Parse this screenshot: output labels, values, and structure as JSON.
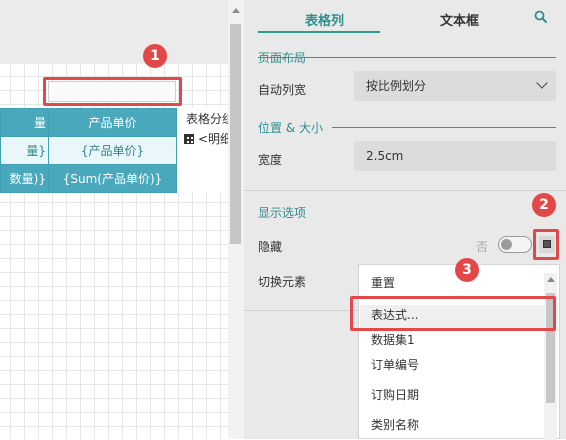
{
  "tabs": {
    "table_column": "表格列",
    "text_box": "文本框"
  },
  "sections": {
    "page_layout": {
      "title": "页面布局",
      "auto_width_label": "自动列宽",
      "auto_width_value": "按比例划分"
    },
    "position_size": {
      "title": "位置 & 大小",
      "width_label": "宽度",
      "width_value": "2.5cm"
    },
    "display_options": {
      "title": "显示选项",
      "hidden_label": "隐藏",
      "toggle_off_text": "否",
      "toggle_element_label": "切换元素"
    }
  },
  "dropdown": {
    "items": [
      "重置",
      "表达式...",
      "数据集1",
      "订单编号",
      "订购日期",
      "类别名称"
    ]
  },
  "table": {
    "header": [
      "量",
      "产品单价"
    ],
    "detail": [
      "量}",
      "{产品单价}"
    ],
    "footer": [
      "数量)}",
      "{Sum(产品单价)}"
    ],
    "group_label": "表格分组",
    "group_item": "<明细"
  },
  "callouts": [
    "1",
    "2",
    "3"
  ],
  "colors": {
    "accent": "#2a9d8f",
    "table_header": "#4aa8bd",
    "table_detail": "#e9f7fb",
    "callout": "#e34848"
  },
  "icons": {
    "search": "search-icon",
    "chevron": "chevron-down-icon",
    "expression": "expression-icon",
    "grid": "table-group-icon"
  }
}
